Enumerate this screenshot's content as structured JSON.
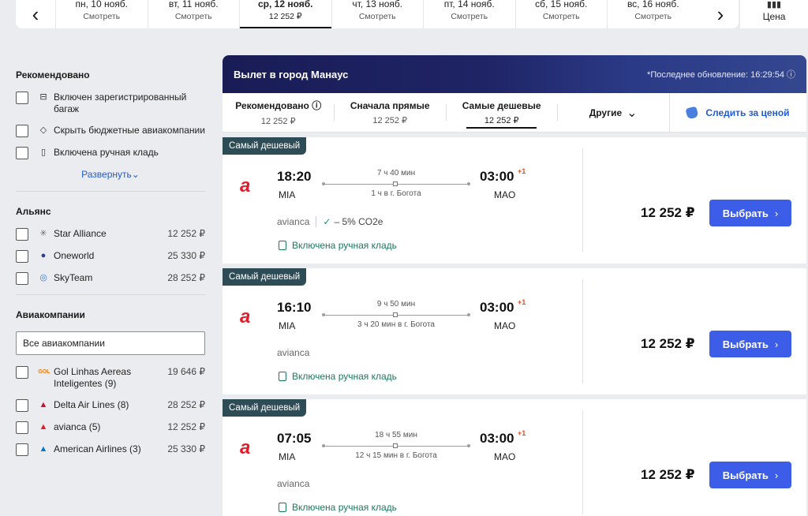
{
  "datebar": {
    "prev_icon": "chevron-left-icon",
    "next_icon": "chevron-right-icon",
    "dates": [
      {
        "day": "пн, 10 нояб.",
        "price": "Смотреть",
        "active": false
      },
      {
        "day": "вт, 11 нояб.",
        "price": "Смотреть",
        "active": false
      },
      {
        "day": "ср, 12 нояб.",
        "price": "12 252 ₽",
        "active": true
      },
      {
        "day": "чт, 13 нояб.",
        "price": "Смотреть",
        "active": false
      },
      {
        "day": "пт, 14 нояб.",
        "price": "Смотреть",
        "active": false
      },
      {
        "day": "сб, 15 нояб.",
        "price": "Смотреть",
        "active": false
      },
      {
        "day": "вс, 16 нояб.",
        "price": "Смотреть",
        "active": false
      }
    ],
    "price_label": "Цена"
  },
  "sidebar": {
    "recommended": {
      "title": "Рекомендовано",
      "items": [
        {
          "label": "Включен зарегистрированный багаж",
          "icon": "luggage-icon"
        },
        {
          "label": "Скрыть бюджетные авиакомпании",
          "icon": "tag-icon"
        },
        {
          "label": "Включена ручная кладь",
          "icon": "bag-icon"
        }
      ],
      "expand_label": "Развернуть"
    },
    "alliance": {
      "title": "Альянс",
      "items": [
        {
          "label": "Star Alliance",
          "price": "12 252 ₽",
          "color": "#6b6b6b"
        },
        {
          "label": "Oneworld",
          "price": "25 330 ₽",
          "color": "#2a3f8f"
        },
        {
          "label": "SkyTeam",
          "price": "28 252 ₽",
          "color": "#3a7bd5"
        }
      ]
    },
    "airlines": {
      "title": "Авиакомпании",
      "search_value": "Все авиакомпании",
      "items": [
        {
          "label": "Gol Linhas Aereas Inteligentes (9)",
          "price": "19 646 ₽",
          "logo": "GOL",
          "color": "#f07a12"
        },
        {
          "label": "Delta Air Lines (8)",
          "price": "28 252 ₽",
          "logo": "▲",
          "color": "#c8102e"
        },
        {
          "label": "avianca (5)",
          "price": "12 252 ₽",
          "logo": "▲",
          "color": "#e11d2c"
        },
        {
          "label": "American Airlines (3)",
          "price": "25 330 ₽",
          "logo": "▲",
          "color": "#0078d2"
        }
      ]
    }
  },
  "main": {
    "banner_title": "Вылет в город Манаус",
    "banner_update": "*Последнее обновление: 16:29:54",
    "tabs": [
      {
        "label": "Рекомендовано",
        "price": "12 252 ₽",
        "active": false
      },
      {
        "label": "Сначала прямые",
        "price": "12 252 ₽",
        "active": false
      },
      {
        "label": "Самые дешевые",
        "price": "12 252 ₽",
        "active": true
      }
    ],
    "other_label": "Другие",
    "watch_label": "Следить за ценой",
    "flights": [
      {
        "badge": "Самый дешевый",
        "dep_time": "18:20",
        "dep_code": "MIA",
        "arr_time": "03:00",
        "arr_plus": "+1",
        "arr_code": "MAO",
        "duration": "7 ч 40 мин",
        "stop": "1 ч в г. Богота",
        "airline": "avianca",
        "eco": "– 5% CO2e",
        "baggage": "Включена ручная кладь",
        "price": "12 252 ₽",
        "select_label": "Выбрать"
      },
      {
        "badge": "Самый дешевый",
        "dep_time": "16:10",
        "dep_code": "MIA",
        "arr_time": "03:00",
        "arr_plus": "+1",
        "arr_code": "MAO",
        "duration": "9 ч 50 мин",
        "stop": "3 ч 20 мин в г. Богота",
        "airline": "avianca",
        "eco": "",
        "baggage": "Включена ручная кладь",
        "price": "12 252 ₽",
        "select_label": "Выбрать"
      },
      {
        "badge": "Самый дешевый",
        "dep_time": "07:05",
        "dep_code": "MIA",
        "arr_time": "03:00",
        "arr_plus": "+1",
        "arr_code": "MAO",
        "duration": "18 ч 55 мин",
        "stop": "12 ч 15 мин в г. Богота",
        "airline": "avianca",
        "eco": "",
        "baggage": "Включена ручная кладь",
        "price": "12 252 ₽",
        "select_label": "Выбрать"
      }
    ]
  }
}
